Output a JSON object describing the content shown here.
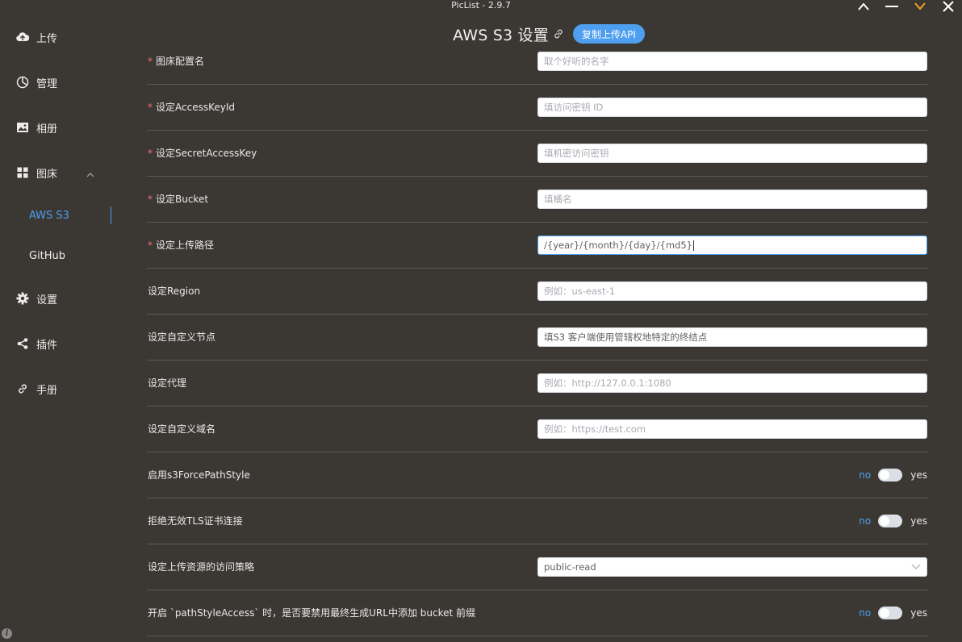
{
  "window": {
    "title": "PicList - 2.9.7"
  },
  "sidebar": {
    "items": [
      {
        "label": "上传",
        "icon": "upload-cloud-icon"
      },
      {
        "label": "管理",
        "icon": "pie-chart-icon"
      },
      {
        "label": "相册",
        "icon": "image-icon"
      },
      {
        "label": "图床",
        "icon": "grid-icon"
      },
      {
        "label": "设置",
        "icon": "gear-icon"
      },
      {
        "label": "插件",
        "icon": "share-icon"
      },
      {
        "label": "手册",
        "icon": "link-icon"
      }
    ],
    "subitems": [
      {
        "label": "AWS S3",
        "active": true
      },
      {
        "label": "GitHub",
        "active": false
      }
    ]
  },
  "header": {
    "title": "AWS S3 设置",
    "copy_api_label": "复制上传API"
  },
  "form": {
    "rows": [
      {
        "label": "图床配置名",
        "required": true,
        "placeholder": "取个好听的名字",
        "value": ""
      },
      {
        "label": "设定AccessKeyId",
        "required": true,
        "placeholder": "填访问密钥 ID",
        "value": ""
      },
      {
        "label": "设定SecretAccessKey",
        "required": true,
        "placeholder": "填机密访问密钥",
        "value": ""
      },
      {
        "label": "设定Bucket",
        "required": true,
        "placeholder": "填桶名",
        "value": ""
      },
      {
        "label": "设定上传路径",
        "required": true,
        "placeholder": "",
        "value": "/{year}/{month}/{day}/{md5}"
      },
      {
        "label": "设定Region",
        "required": false,
        "placeholder": "例如：us-east-1",
        "value": ""
      },
      {
        "label": "设定自定义节点",
        "required": false,
        "placeholder": "填S3 客户端使用管辖权地特定的终结点",
        "value": ""
      },
      {
        "label": "设定代理",
        "required": false,
        "placeholder": "例如：http://127.0.0.1:1080",
        "value": ""
      },
      {
        "label": "设定自定义域名",
        "required": false,
        "placeholder": "例如：https://test.com",
        "value": ""
      }
    ],
    "switch_rows": [
      {
        "label": "启用s3ForcePathStyle",
        "off_label": "no",
        "on_label": "yes",
        "on": false
      },
      {
        "label": "拒绝无效TLS证书连接",
        "off_label": "no",
        "on_label": "yes",
        "on": false
      }
    ],
    "acl_row": {
      "label": "设定上传资源的访问策略",
      "value": "public-read"
    },
    "path_style_row": {
      "label": "开启 `pathStyleAccess` 时，是否要禁用最终生成URL中添加 bucket 前缀",
      "off_label": "no",
      "on_label": "yes",
      "on": false
    }
  },
  "colors": {
    "accent": "#4e9ff0",
    "background": "#3b3834",
    "required": "#f56c6c"
  }
}
